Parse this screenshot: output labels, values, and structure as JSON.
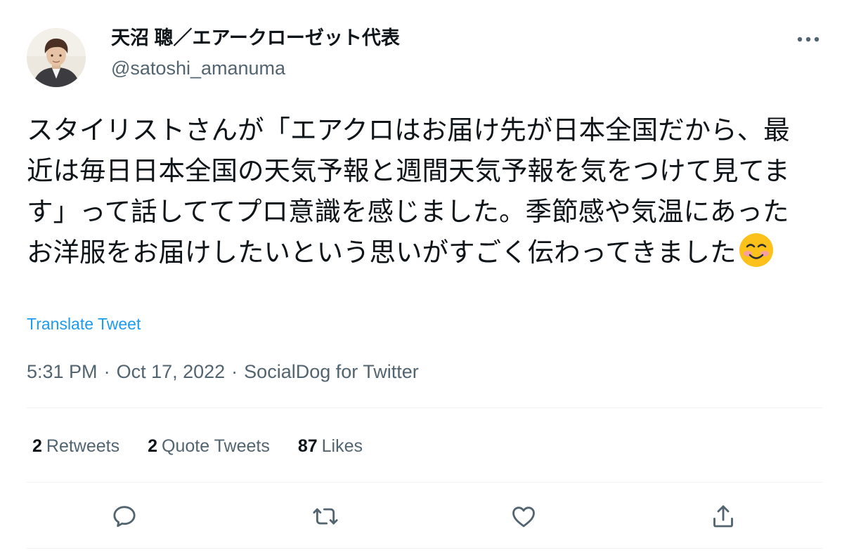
{
  "author": {
    "display_name": "天沼 聰／エアークローゼット代表",
    "handle": "@satoshi_amanuma",
    "avatar_icon": "profile-photo"
  },
  "more_icon": "more-horizontal-icon",
  "tweet": {
    "text": "スタイリストさんが「エアクロはお届け先が日本全国だから、最近は毎日日本全国の天気予報と週間天気予報を気をつけて見てます」って話しててプロ意識を感じました。季節感や気温にあったお洋服をお届けしたいという思いがすごく伝わってきました",
    "emoji": "smiling-face-with-blush-emoji"
  },
  "translate_label": "Translate Tweet",
  "meta": {
    "time": "5:31 PM",
    "separator": "·",
    "date": "Oct 17, 2022",
    "source": "SocialDog for Twitter"
  },
  "stats": {
    "retweets_count": "2",
    "retweets_label": "Retweets",
    "quotes_count": "2",
    "quotes_label": "Quote Tweets",
    "likes_count": "87",
    "likes_label": "Likes"
  },
  "actions": [
    "reply-icon",
    "retweet-icon",
    "like-icon",
    "share-icon"
  ],
  "colors": {
    "text": "#0f1419",
    "secondary": "#536471",
    "link": "#1d9bf0",
    "divider": "#eff3f4"
  }
}
